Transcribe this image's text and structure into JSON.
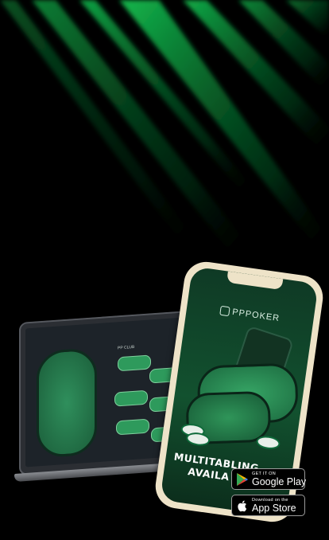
{
  "brand": {
    "name": "PPPOKER"
  },
  "tagline": {
    "line1": "MULTITABLING",
    "line2": "AVAILA"
  },
  "laptop": {
    "club_label": "PP CLUB"
  },
  "store_buttons": {
    "google": {
      "small": "GET IT ON",
      "big": "Google Play"
    },
    "apple": {
      "small": "Download on the",
      "big": "App Store"
    }
  },
  "colors": {
    "accent": "#2bd36a",
    "background": "#000000",
    "phone_frame": "#eee3c8"
  }
}
